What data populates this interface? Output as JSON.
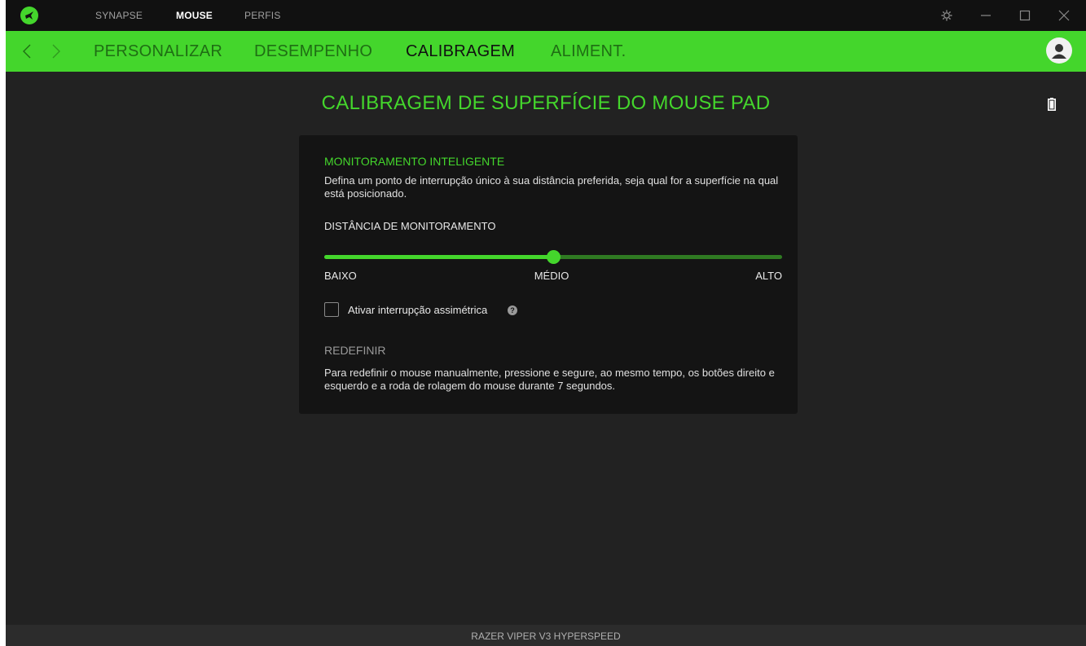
{
  "topbar": {
    "logo_icon": "razer-snake-icon",
    "tabs": [
      {
        "label": "SYNAPSE",
        "active": false
      },
      {
        "label": "MOUSE",
        "active": true
      },
      {
        "label": "PERFIS",
        "active": false
      }
    ],
    "controls": [
      "settings-icon",
      "minimize-icon",
      "maximize-icon",
      "close-icon"
    ]
  },
  "navbar": {
    "tabs": [
      {
        "label": "PERSONALIZAR",
        "active": false
      },
      {
        "label": "DESEMPENHO",
        "active": false
      },
      {
        "label": "CALIBRAGEM",
        "active": true
      },
      {
        "label": "ALIMENT.",
        "active": false
      }
    ],
    "accent": "#44d62c"
  },
  "main": {
    "title": "CALIBRAGEM DE SUPERFÍCIE DO MOUSE PAD",
    "battery_icon": "battery-icon"
  },
  "panel": {
    "smart_tracking": {
      "title": "MONITORAMENTO INTELIGENTE",
      "description": "Defina um ponto de interrupção único à sua distância preferida, seja qual for a superfície na qual está posicionado."
    },
    "distance": {
      "label": "DISTÂNCIA DE MONITORAMENTO",
      "min_label": "BAIXO",
      "mid_label": "MÉDIO",
      "max_label": "ALTO",
      "value_fraction": 0.5
    },
    "asymmetric": {
      "label": "Ativar interrupção assimétrica",
      "checked": false
    },
    "reset": {
      "title": "REDEFINIR",
      "description": "Para redefinir o mouse manualmente, pressione e segure, ao mesmo tempo, os botões direito e esquerdo e a roda de rolagem do mouse durante 7 segundos."
    }
  },
  "footer": {
    "device_name": "RAZER VIPER V3 HYPERSPEED"
  }
}
